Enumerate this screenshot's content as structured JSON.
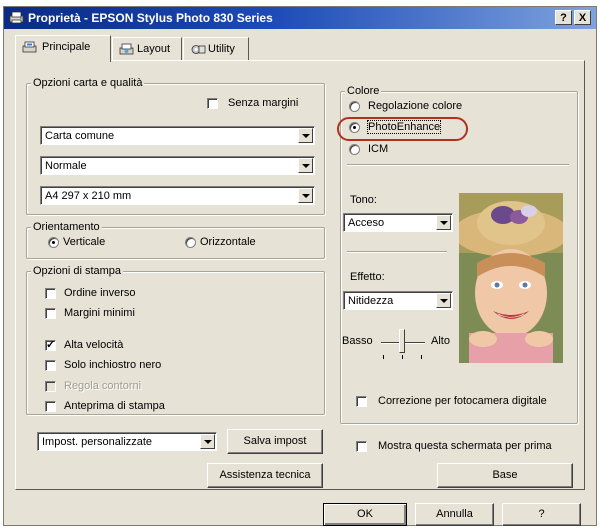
{
  "window": {
    "title": "Proprietà - EPSON Stylus Photo 830 Series",
    "help_button": "?",
    "close_button": "X"
  },
  "tabs": [
    {
      "label": "Principale",
      "active": true
    },
    {
      "label": "Layout",
      "active": false
    },
    {
      "label": "Utility",
      "active": false
    }
  ],
  "paper_quality": {
    "legend": "Opzioni carta e qualità",
    "borderless_label": "Senza margini",
    "borderless_checked": false,
    "media_type": "Carta comune",
    "quality": "Normale",
    "paper_size": "A4 297 x 210 mm"
  },
  "orientation": {
    "legend": "Orientamento",
    "portrait_label": "Verticale",
    "landscape_label": "Orizzontale",
    "selected": "Verticale"
  },
  "print_options": {
    "legend": "Opzioni di stampa",
    "items": [
      {
        "label": "Ordine inverso",
        "checked": false,
        "enabled": true
      },
      {
        "label": "Margini minimi",
        "checked": false,
        "enabled": true
      },
      {
        "label": "Alta velocità",
        "checked": true,
        "enabled": true
      },
      {
        "label": "Solo inchiostro nero",
        "checked": false,
        "enabled": true
      },
      {
        "label": "Regola contorni",
        "checked": false,
        "enabled": false
      },
      {
        "label": "Anteprima di stampa",
        "checked": false,
        "enabled": true
      }
    ]
  },
  "settings": {
    "custom_select": "Impost. personalizzate",
    "save_button": "Salva impost",
    "support_button": "Assistenza tecnica"
  },
  "color": {
    "legend": "Colore",
    "options": [
      {
        "label": "Regolazione colore",
        "selected": false
      },
      {
        "label": "PhotoEnhance",
        "selected": true
      },
      {
        "label": "ICM",
        "selected": false
      }
    ],
    "tone_label": "Tono:",
    "tone_value": "Acceso",
    "effect_label": "Effetto:",
    "effect_value": "Nitidezza",
    "slider_low": "Basso",
    "slider_high": "Alto",
    "digital_camera_label": "Correzione per fotocamera digitale",
    "digital_camera_checked": false,
    "highlight_color": "#b2301e"
  },
  "show_first_label": "Mostra questa schermata per prima",
  "show_first_checked": false,
  "base_button": "Base",
  "footer": {
    "ok": "OK",
    "cancel": "Annulla",
    "help": "?"
  },
  "icons": [
    "printer-icon",
    "principale-tab-icon",
    "layout-tab-icon",
    "utility-tab-icon"
  ]
}
